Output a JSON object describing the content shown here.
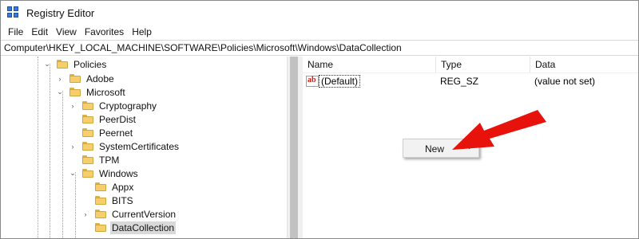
{
  "window": {
    "title": "Registry Editor"
  },
  "menu": [
    "File",
    "Edit",
    "View",
    "Favorites",
    "Help"
  ],
  "address": "Computer\\HKEY_LOCAL_MACHINE\\SOFTWARE\\Policies\\Microsoft\\Windows\\DataCollection",
  "tree": {
    "items": [
      {
        "label": "Policies",
        "expanded": true
      },
      {
        "label": "Adobe",
        "expanded": false
      },
      {
        "label": "Microsoft",
        "expanded": true
      },
      {
        "label": "Cryptography",
        "expanded": false
      },
      {
        "label": "PeerDist",
        "expanded": null
      },
      {
        "label": "Peernet",
        "expanded": null
      },
      {
        "label": "SystemCertificates",
        "expanded": false
      },
      {
        "label": "TPM",
        "expanded": null
      },
      {
        "label": "Windows",
        "expanded": true
      },
      {
        "label": "Appx",
        "expanded": null
      },
      {
        "label": "BITS",
        "expanded": null
      },
      {
        "label": "CurrentVersion",
        "expanded": false
      },
      {
        "label": "DataCollection",
        "expanded": null,
        "selected": true
      }
    ]
  },
  "list": {
    "columns": [
      "Name",
      "Type",
      "Data"
    ],
    "rows": [
      {
        "icon": "string-value-icon",
        "icon_text": "ab",
        "name": "(Default)",
        "type": "REG_SZ",
        "data": "(value not set)"
      }
    ]
  },
  "context_menu": {
    "items": [
      {
        "label": "New",
        "submenu_arrow": "›"
      }
    ]
  },
  "colors": {
    "annotation_arrow": "#e8120c",
    "folder": "#f5cf6b",
    "selection": "#d9d9d9"
  }
}
